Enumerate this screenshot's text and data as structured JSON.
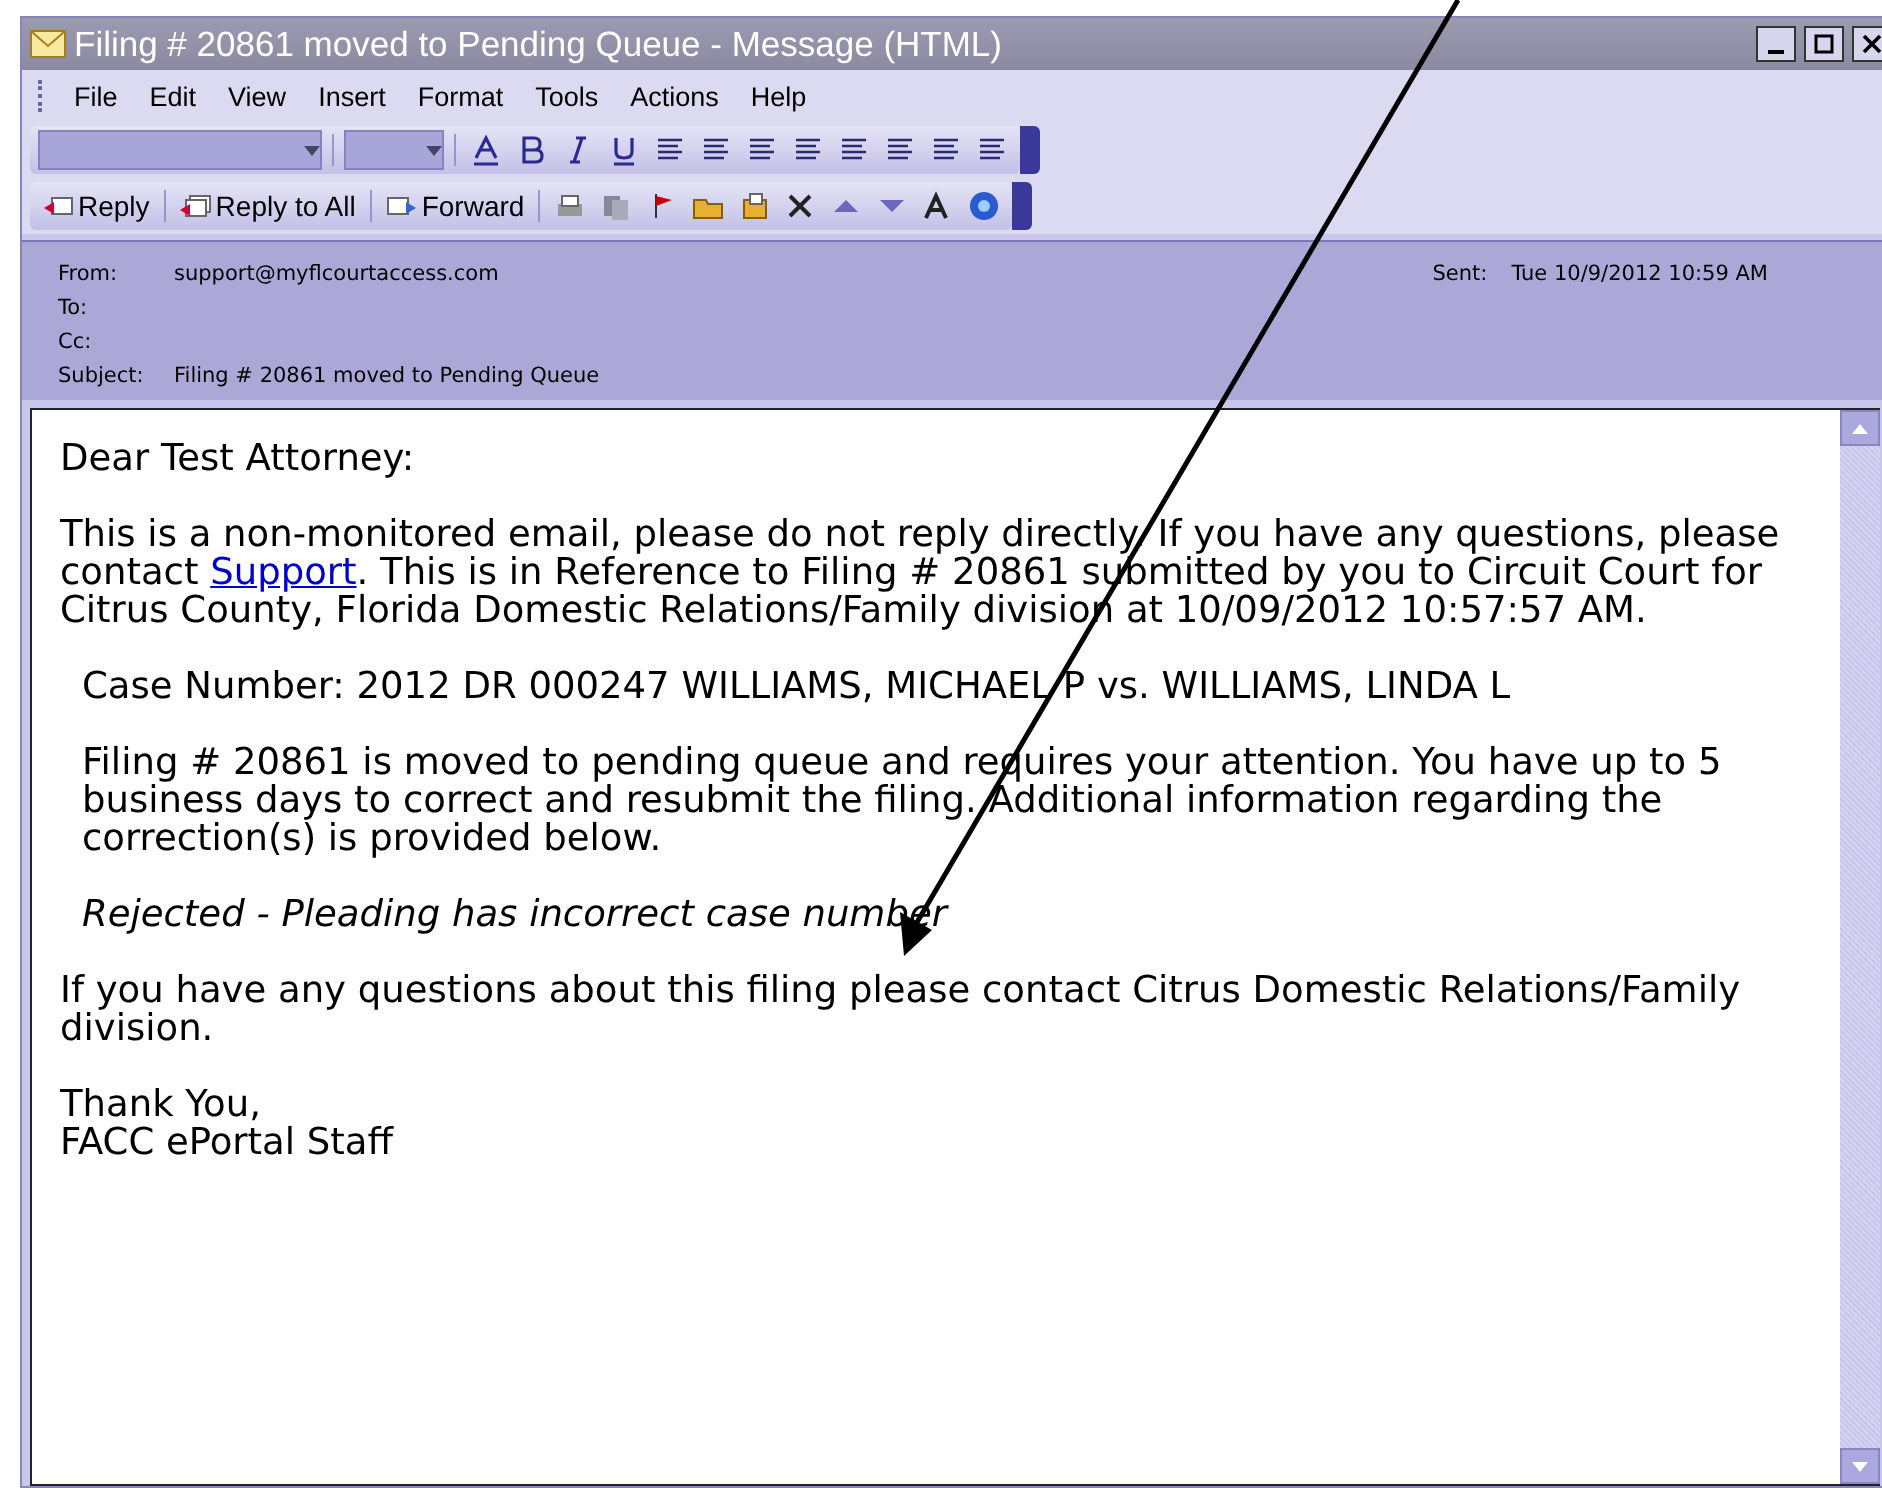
{
  "window": {
    "title": "Filing # 20861 moved to Pending Queue - Message (HTML)"
  },
  "menu": [
    "File",
    "Edit",
    "View",
    "Insert",
    "Format",
    "Tools",
    "Actions",
    "Help"
  ],
  "toolbar": [
    {
      "label": "Reply"
    },
    {
      "label": "Reply to All"
    },
    {
      "label": "Forward"
    }
  ],
  "header": {
    "from_label": "From:",
    "from": "support@myflcourtaccess.com",
    "sent_label": "Sent:",
    "sent": "Tue 10/9/2012 10:59 AM",
    "to_label": "To:",
    "cc_label": "Cc:",
    "subject_label": "Subject:",
    "subject": "Filing # 20861 moved to Pending Queue"
  },
  "body": [
    {
      "kind": "plain",
      "parts": [
        {
          "text": "Dear Test Attorney:"
        }
      ]
    },
    {
      "kind": "plain",
      "parts": [
        {
          "text": "This is a non-monitored email, please do not reply directly. If you have any questions, please contact "
        },
        {
          "kind": "link",
          "text": "Support"
        },
        {
          "text": ". This is in Reference to Filing # 20861 submitted by you to Circuit Court for Citrus County, Florida Domestic Relations/Family division at 10/09/2012 10:57:57 AM."
        }
      ]
    },
    {
      "kind": "indented",
      "parts": [
        {
          "text": "Case Number: 2012 DR 000247 WILLIAMS, MICHAEL P vs. WILLIAMS, LINDA L"
        }
      ]
    },
    {
      "kind": "indented",
      "parts": [
        {
          "text": "Filing # 20861 is moved to pending queue and requires your attention. You have up to 5 business days to correct and resubmit the filing. Additional information regarding the correction(s) is provided below."
        }
      ]
    },
    {
      "kind": "note",
      "parts": [
        {
          "text": "Rejected - Pleading has incorrect case number"
        }
      ]
    },
    {
      "kind": "plain",
      "parts": [
        {
          "text": "If you have any questions about this filing please contact Citrus Domestic Relations/Family division."
        }
      ]
    },
    {
      "kind": "signature",
      "parts": [
        {
          "text": "Thank You,"
        }
      ]
    },
    {
      "kind": "signature-last",
      "parts": [
        {
          "text": "FACC ePortal Staff"
        }
      ]
    }
  ]
}
